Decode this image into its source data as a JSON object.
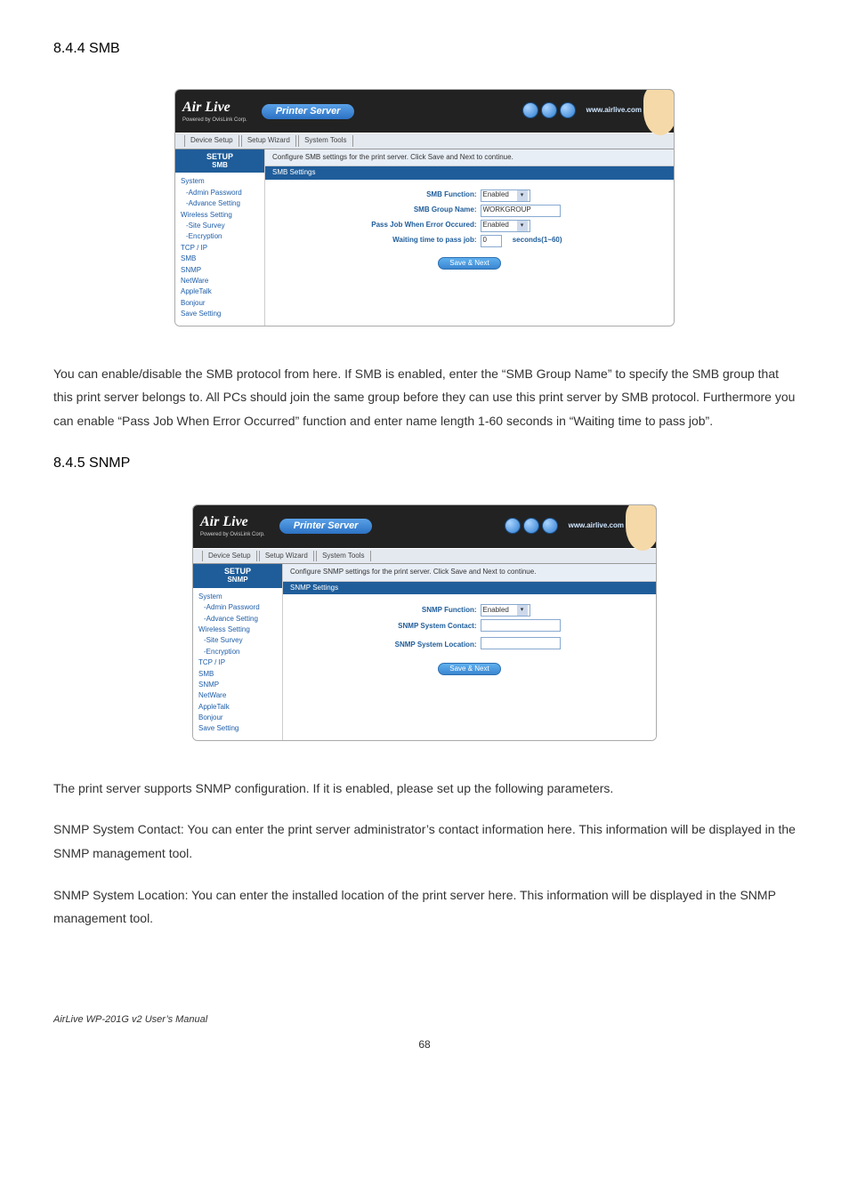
{
  "sections": {
    "smb": {
      "heading": "8.4.4 SMB"
    },
    "snmp": {
      "heading": "8.4.5 SNMP"
    }
  },
  "smb_shot": {
    "logo": "Air Live",
    "logo_sub": "Powered by OvisLink Corp.",
    "title": "Printer Server",
    "url": "www.airlive.com",
    "tabs": [
      "Device Setup",
      "Setup Wizard",
      "System Tools"
    ],
    "current_sec": "SETUP",
    "current_sub": "SMB",
    "menu": [
      "System",
      "-Admin Password",
      "-Advance Setting",
      "Wireless Setting",
      "-Site Survey",
      "-Encryption",
      "TCP / IP",
      "SMB",
      "SNMP",
      "NetWare",
      "AppleTalk",
      "Bonjour",
      "Save Setting"
    ],
    "desc": "Configure SMB settings for the print server. Click Save and Next to continue.",
    "bluebar": "SMB Settings",
    "fields": {
      "func_label": "SMB Function:",
      "func_value": "Enabled",
      "group_label": "SMB Group Name:",
      "group_value": "WORKGROUP",
      "pass_label": "Pass Job When Error Occured:",
      "pass_value": "Enabled",
      "wait_label": "Waiting time to pass job:",
      "wait_value": "0",
      "wait_suffix": "seconds(1~60)"
    },
    "save_btn": "Save & Next"
  },
  "snmp_shot": {
    "logo": "Air Live",
    "logo_sub": "Powered by OvisLink Corp.",
    "title": "Printer Server",
    "url": "www.airlive.com",
    "tabs": [
      "Device Setup",
      "Setup Wizard",
      "System Tools"
    ],
    "current_sec": "SETUP",
    "current_sub": "SNMP",
    "menu": [
      "System",
      "-Admin Password",
      "-Advance Setting",
      "Wireless Setting",
      "-Site Survey",
      "-Encryption",
      "TCP / IP",
      "SMB",
      "SNMP",
      "NetWare",
      "AppleTalk",
      "Bonjour",
      "Save Setting"
    ],
    "desc": "Configure SNMP settings for the print server. Click Save and Next to continue.",
    "bluebar": "SNMP Settings",
    "fields": {
      "func_label": "SNMP Function:",
      "func_value": "Enabled",
      "contact_label": "SNMP System Contact:",
      "contact_value": "",
      "loc_label": "SNMP System Location:",
      "loc_value": ""
    },
    "save_btn": "Save & Next"
  },
  "body": {
    "p_smb": "You can enable/disable the SMB protocol from here. If SMB is enabled, enter the “SMB Group Name” to specify the SMB group that this print server belongs to. All PCs should join the same group before they can use this print server by SMB protocol. Furthermore you can enable “Pass Job When Error Occurred” function and enter name length 1-60 seconds in “Waiting time to pass job”.",
    "p_snmp_1": "The print server supports SNMP configuration. If it is enabled, please set up the following parameters.",
    "p_snmp_2": "SNMP System Contact: You can enter the print server administrator’s contact information here. This information will be displayed in the SNMP management tool.",
    "p_snmp_3": "SNMP System Location: You can enter the installed location of the print server here. This information will be displayed in the SNMP management tool."
  },
  "footer": {
    "doc": "AirLive WP-201G v2 User’s Manual",
    "page": "68"
  }
}
